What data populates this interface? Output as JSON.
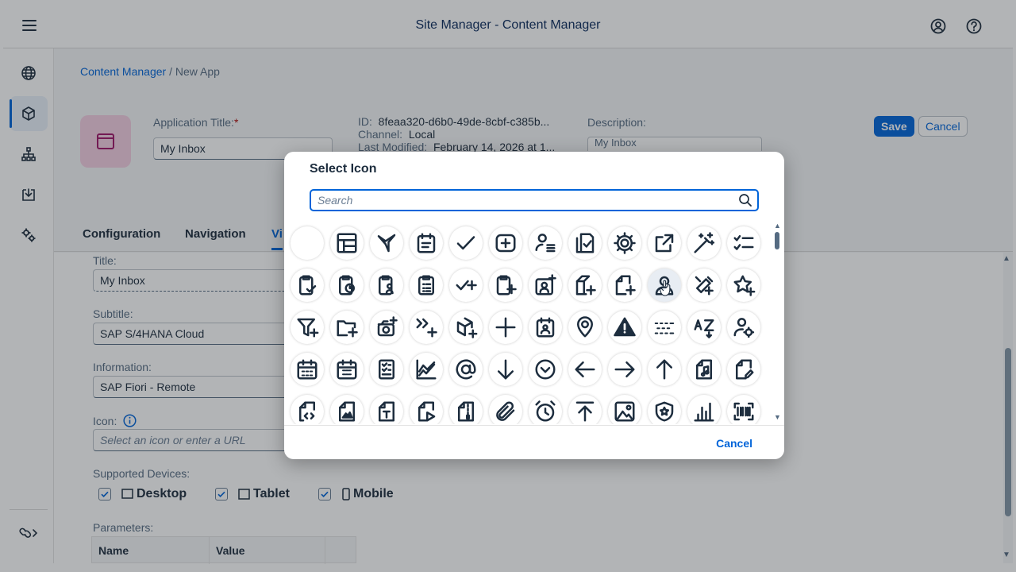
{
  "shell": {
    "title": "Site Manager - Content Manager"
  },
  "breadcrumb": {
    "root": "Content Manager",
    "separator": " / ",
    "current": "New App"
  },
  "app": {
    "title_label": "Application Title:",
    "required_mark": "*",
    "title_value": "My Inbox",
    "id_label": "ID:",
    "id_value": "8feaa320-d6b0-49de-8cbf-c385b...",
    "channel_label": "Channel:",
    "channel_value": "Local",
    "modified_label": "Last Modified:",
    "modified_value": "February 14, 2026 at 1...",
    "description_label": "Description:",
    "description_value": "My Inbox",
    "save_label": "Save",
    "cancel_label": "Cancel"
  },
  "tabs": [
    {
      "label": "Configuration"
    },
    {
      "label": "Navigation"
    },
    {
      "label": "Vi"
    }
  ],
  "form": {
    "title_label": "Title:",
    "title_value": "My Inbox",
    "subtitle_label": "Subtitle:",
    "subtitle_value": "SAP S/4HANA Cloud",
    "information_label": "Information:",
    "information_value": "SAP Fiori - Remote",
    "icon_label": "Icon:",
    "icon_placeholder": "Select an icon or enter a URL",
    "devices_label": "Supported Devices:",
    "devices": [
      {
        "label": "Desktop",
        "checked": true
      },
      {
        "label": "Tablet",
        "checked": true
      },
      {
        "label": "Mobile",
        "checked": true
      }
    ],
    "parameters_label": "Parameters:",
    "param_columns": [
      "Name",
      "Value"
    ]
  },
  "dialog": {
    "title": "Select Icon",
    "search_placeholder": "Search",
    "cancel_label": "Cancel",
    "hovered_icon": "user-icon",
    "icons": [
      "blank-icon",
      "table-layout-icon",
      "sap-logo-icon",
      "meeting-icon",
      "checkmark-icon",
      "medical-kit-icon",
      "user-list-icon",
      "document-check-icon",
      "gear-icon",
      "share-icon",
      "magic-wand-icon",
      "checklist-icon",
      "clipboard-check-icon",
      "clipboard-clock-icon",
      "clipboard-user-icon",
      "clipboard-list-icon",
      "check-plus-icon",
      "clipboard-plus-icon",
      "contact-add-icon",
      "folder-plus-icon",
      "document-plus-icon",
      "user-icon",
      "tools-plus-icon",
      "star-plus-icon",
      "filter-plus-icon",
      "folder-add-icon",
      "camera-plus-icon",
      "forward-plus-icon",
      "cube-plus-icon",
      "plus-icon",
      "calendar-user-icon",
      "location-icon",
      "warning-icon",
      "dotted-lines-icon",
      "sort-az-icon",
      "user-settings-icon",
      "calendar-icon",
      "calendar-grid-icon",
      "checklist-document-icon",
      "area-chart-icon",
      "at-sign-icon",
      "arrow-down-icon",
      "circle-chevron-icon",
      "arrow-left-icon",
      "arrow-right-icon",
      "arrow-up-icon",
      "document-music-icon",
      "document-edit-icon",
      "document-code-icon",
      "document-image-icon",
      "document-text-icon",
      "document-video-icon",
      "document-zip-icon",
      "paperclip-icon",
      "alarm-icon",
      "upload-icon",
      "image-icon",
      "shield-star-icon",
      "bar-chart-icon",
      "barcode-icon"
    ]
  }
}
